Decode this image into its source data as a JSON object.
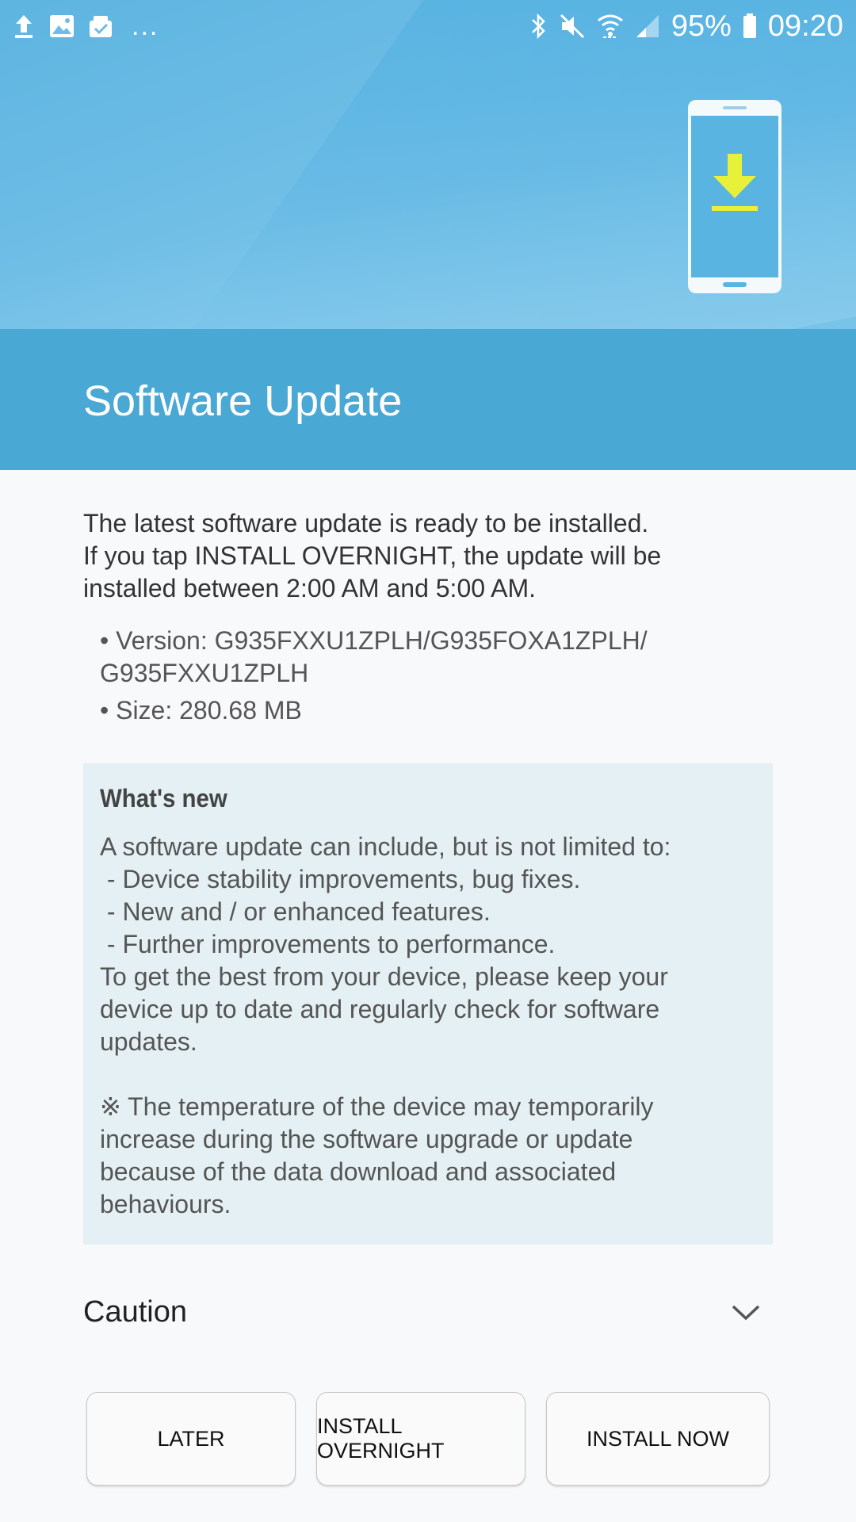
{
  "status_bar": {
    "icons_left": [
      "upload-icon",
      "image-icon",
      "clipboard-check-icon"
    ],
    "more": "...",
    "icons_right": [
      "bluetooth-icon",
      "mute-icon",
      "wifi-icon",
      "signal-icon"
    ],
    "battery": "95%",
    "time": "09:20"
  },
  "header": {
    "title": "Software Update"
  },
  "intro": [
    "The latest software update is ready to be installed.",
    "If you tap INSTALL OVERNIGHT, the update will be",
    "installed between 2:00 AM and 5:00 AM."
  ],
  "details": {
    "version_line1": "• Version: G935FXXU1ZPLH/G935FOXA1ZPLH/",
    "version_line2": "G935FXXU1ZPLH",
    "size": "• Size: 280.68 MB"
  },
  "whats_new": {
    "heading": "What's new",
    "lines": [
      "A software update can include, but is not limited to:",
      " - Device stability improvements, bug fixes.",
      " - New and / or enhanced features.",
      " - Further improvements to performance.",
      "To get the best from your device, please keep your",
      "device up to date and regularly check for software",
      "updates."
    ],
    "note_lines": [
      "※ The temperature of the device may temporarily",
      "increase during the software upgrade or update",
      "because of the data download and associated",
      "behaviours."
    ]
  },
  "caution": {
    "label": "Caution"
  },
  "buttons": {
    "later": "LATER",
    "install_overnight": "INSTALL OVERNIGHT",
    "install_now": "INSTALL NOW"
  },
  "colors": {
    "title_band": "#4aa8d4",
    "whats_new_bg": "#e4f0f3",
    "download_arrow": "#e8f03a"
  }
}
